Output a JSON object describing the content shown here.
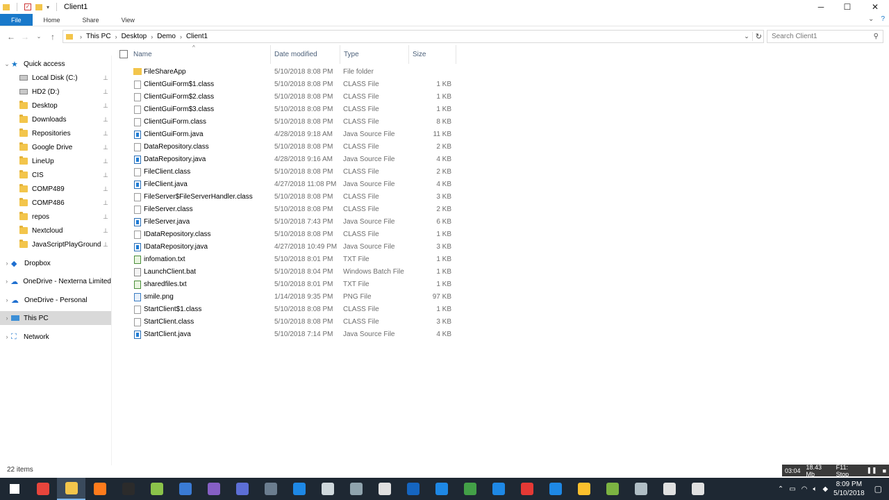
{
  "window": {
    "title": "Client1",
    "controls": {
      "minimize": "─",
      "maximize": "☐",
      "close": "✕"
    }
  },
  "ribbon": {
    "tabs": [
      "File",
      "Home",
      "Share",
      "View"
    ]
  },
  "address": {
    "crumbs": [
      "This PC",
      "Desktop",
      "Demo",
      "Client1"
    ],
    "search_placeholder": "Search Client1"
  },
  "nav": {
    "quick_access": "Quick access",
    "quick_items": [
      {
        "label": "Local Disk (C:)",
        "icon": "disk-icon"
      },
      {
        "label": "HD2 (D:)",
        "icon": "disk-icon"
      },
      {
        "label": "Desktop",
        "icon": "folder-icon"
      },
      {
        "label": "Downloads",
        "icon": "folder-icon"
      },
      {
        "label": "Repositories",
        "icon": "folder-icon"
      },
      {
        "label": "Google Drive",
        "icon": "folder-icon"
      },
      {
        "label": "LineUp",
        "icon": "folder-icon"
      },
      {
        "label": "CIS",
        "icon": "folder-icon"
      },
      {
        "label": "COMP489",
        "icon": "folder-icon"
      },
      {
        "label": "COMP486",
        "icon": "folder-icon"
      },
      {
        "label": "repos",
        "icon": "folder-icon"
      },
      {
        "label": "Nextcloud",
        "icon": "folder-icon"
      },
      {
        "label": "JavaScriptPlayGround",
        "icon": "folder-icon"
      }
    ],
    "dropbox": "Dropbox",
    "onedrive_nexterna": "OneDrive - Nexterna Limited",
    "onedrive_personal": "OneDrive - Personal",
    "this_pc": "This PC",
    "network": "Network"
  },
  "columns": {
    "name": "Name",
    "date": "Date modified",
    "type": "Type",
    "size": "Size"
  },
  "files": [
    {
      "name": "FileShareApp",
      "date": "5/10/2018 8:08 PM",
      "type": "File folder",
      "size": "",
      "icon": "folder"
    },
    {
      "name": "ClientGuiForm$1.class",
      "date": "5/10/2018 8:08 PM",
      "type": "CLASS File",
      "size": "1 KB",
      "icon": "file"
    },
    {
      "name": "ClientGuiForm$2.class",
      "date": "5/10/2018 8:08 PM",
      "type": "CLASS File",
      "size": "1 KB",
      "icon": "file"
    },
    {
      "name": "ClientGuiForm$3.class",
      "date": "5/10/2018 8:08 PM",
      "type": "CLASS File",
      "size": "1 KB",
      "icon": "file"
    },
    {
      "name": "ClientGuiForm.class",
      "date": "5/10/2018 8:08 PM",
      "type": "CLASS File",
      "size": "8 KB",
      "icon": "file"
    },
    {
      "name": "ClientGuiForm.java",
      "date": "4/28/2018 9:18 AM",
      "type": "Java Source File",
      "size": "11 KB",
      "icon": "java"
    },
    {
      "name": "DataRepository.class",
      "date": "5/10/2018 8:08 PM",
      "type": "CLASS File",
      "size": "2 KB",
      "icon": "file"
    },
    {
      "name": "DataRepository.java",
      "date": "4/28/2018 9:16 AM",
      "type": "Java Source File",
      "size": "4 KB",
      "icon": "java"
    },
    {
      "name": "FileClient.class",
      "date": "5/10/2018 8:08 PM",
      "type": "CLASS File",
      "size": "2 KB",
      "icon": "file"
    },
    {
      "name": "FileClient.java",
      "date": "4/27/2018 11:08 PM",
      "type": "Java Source File",
      "size": "4 KB",
      "icon": "java"
    },
    {
      "name": "FileServer$FileServerHandler.class",
      "date": "5/10/2018 8:08 PM",
      "type": "CLASS File",
      "size": "3 KB",
      "icon": "file"
    },
    {
      "name": "FileServer.class",
      "date": "5/10/2018 8:08 PM",
      "type": "CLASS File",
      "size": "2 KB",
      "icon": "file"
    },
    {
      "name": "FileServer.java",
      "date": "5/10/2018 7:43 PM",
      "type": "Java Source File",
      "size": "6 KB",
      "icon": "java"
    },
    {
      "name": "IDataRepository.class",
      "date": "5/10/2018 8:08 PM",
      "type": "CLASS File",
      "size": "1 KB",
      "icon": "file"
    },
    {
      "name": "IDataRepository.java",
      "date": "4/27/2018 10:49 PM",
      "type": "Java Source File",
      "size": "3 KB",
      "icon": "java"
    },
    {
      "name": "infomation.txt",
      "date": "5/10/2018 8:01 PM",
      "type": "TXT File",
      "size": "1 KB",
      "icon": "txt"
    },
    {
      "name": "LaunchClient.bat",
      "date": "5/10/2018 8:04 PM",
      "type": "Windows Batch File",
      "size": "1 KB",
      "icon": "bat"
    },
    {
      "name": "sharedfiles.txt",
      "date": "5/10/2018 8:01 PM",
      "type": "TXT File",
      "size": "1 KB",
      "icon": "txt"
    },
    {
      "name": "smile.png",
      "date": "1/14/2018 9:35 PM",
      "type": "PNG File",
      "size": "97 KB",
      "icon": "png"
    },
    {
      "name": "StartClient$1.class",
      "date": "5/10/2018 8:08 PM",
      "type": "CLASS File",
      "size": "1 KB",
      "icon": "file"
    },
    {
      "name": "StartClient.class",
      "date": "5/10/2018 8:08 PM",
      "type": "CLASS File",
      "size": "3 KB",
      "icon": "file"
    },
    {
      "name": "StartClient.java",
      "date": "5/10/2018 7:14 PM",
      "type": "Java Source File",
      "size": "4 KB",
      "icon": "java"
    }
  ],
  "status": {
    "item_count": "22 items"
  },
  "recorder": {
    "time": "03:04",
    "size": "18.43 Mb",
    "stop": "F11: Stop"
  },
  "taskbar": {
    "apps": [
      {
        "name": "start-icon",
        "color": "#ffffff"
      },
      {
        "name": "chrome-icon",
        "color": "#e8453c"
      },
      {
        "name": "file-explorer-icon",
        "color": "#f3c54b"
      },
      {
        "name": "firefox-icon",
        "color": "#ff7b1c"
      },
      {
        "name": "terminal-icon",
        "color": "#2b2b2b"
      },
      {
        "name": "notepad-plus-icon",
        "color": "#8bc34a"
      },
      {
        "name": "thunderbird-icon",
        "color": "#3a7bd5"
      },
      {
        "name": "visual-studio-icon",
        "color": "#865fc5"
      },
      {
        "name": "network-tool-icon",
        "color": "#5d6fd6"
      },
      {
        "name": "keepass-icon",
        "color": "#6b7d8f"
      },
      {
        "name": "teamviewer-icon",
        "color": "#1e88e5"
      },
      {
        "name": "inkscape-icon",
        "color": "#cfd8dc"
      },
      {
        "name": "save-app-icon",
        "color": "#90a4ae"
      },
      {
        "name": "calculator-icon",
        "color": "#e0e0e0"
      },
      {
        "name": "sql-tool-icon",
        "color": "#1565c0"
      },
      {
        "name": "messenger-icon",
        "color": "#1e88e5"
      },
      {
        "name": "browser-icon",
        "color": "#43a047"
      },
      {
        "name": "vscode-icon",
        "color": "#1e88e5"
      },
      {
        "name": "app-icon",
        "color": "#e53935"
      },
      {
        "name": "remote-desktop-icon",
        "color": "#1e88e5"
      },
      {
        "name": "keep-icon",
        "color": "#fbc02d"
      },
      {
        "name": "android-studio-icon",
        "color": "#7cb342"
      },
      {
        "name": "window-app-icon",
        "color": "#b0bec5"
      },
      {
        "name": "java-icon",
        "color": "#e0e0e0"
      },
      {
        "name": "java-icon-2",
        "color": "#e0e0e0"
      }
    ],
    "clock_time": "8:09 PM",
    "clock_date": "5/10/2018"
  }
}
